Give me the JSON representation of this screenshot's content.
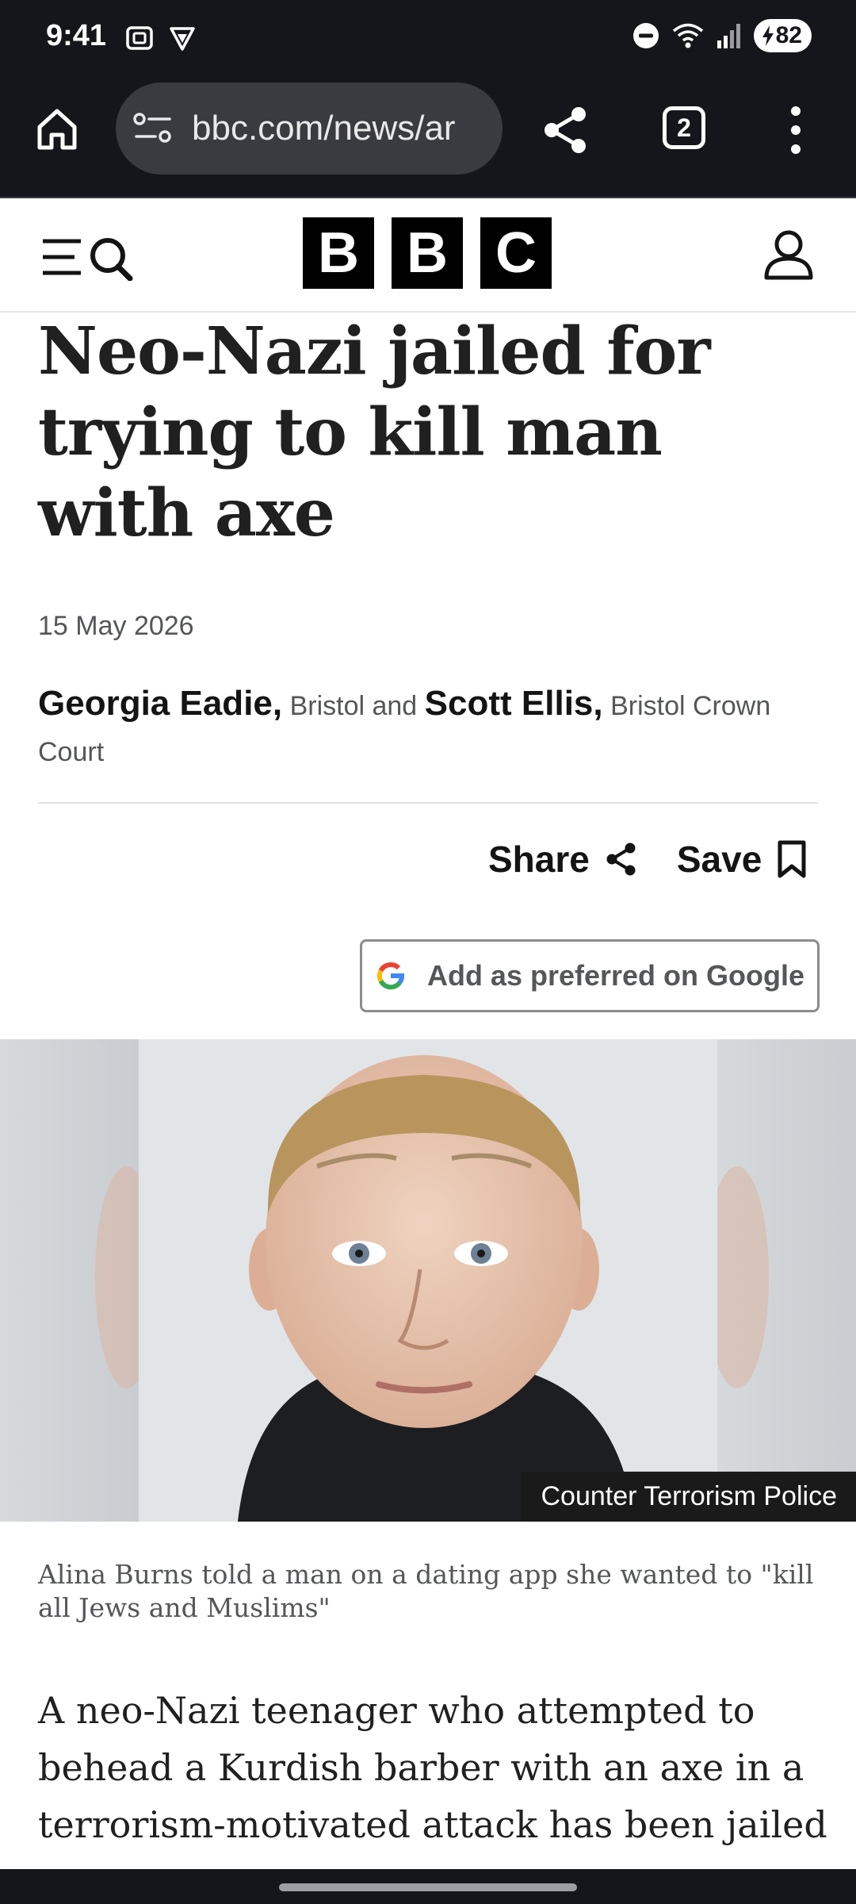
{
  "status_bar": {
    "time": "9:41",
    "battery": "82",
    "icons": [
      "screenshot-icon",
      "vpn-icon",
      "dnd-icon",
      "wifi-icon",
      "signal-icon",
      "battery-charging-icon"
    ]
  },
  "browser": {
    "url": "bbc.com/news/ar",
    "tab_count": "2",
    "icons": [
      "home-icon",
      "site-settings-icon",
      "share-icon",
      "tabs-icon",
      "more-vert-icon"
    ]
  },
  "site_header": {
    "logo": [
      "B",
      "B",
      "C"
    ],
    "icons": [
      "menu-search-icon",
      "account-icon"
    ]
  },
  "article": {
    "headline": "Neo-Nazi jailed for trying to kill man with axe",
    "date": "15 May 2026",
    "byline": {
      "author1": "Georgia Eadie,",
      "location1": "Bristol",
      "conjunction": "and",
      "author2": "Scott Ellis,",
      "location2": "Bristol Crown Court"
    },
    "share_label": "Share",
    "save_label": "Save",
    "google_button_label": "Add as preferred on Google",
    "image_credit": "Counter Terrorism Police",
    "image_caption": "Alina Burns told a man on a dating app she wanted to \"kill all Jews and Muslims\"",
    "body_first_paragraph": "A neo-Nazi teenager who attempted to behead a Kurdish barber with an axe in a terrorism-motivated attack has been jailed"
  },
  "colors": {
    "system_bar": "#15161b",
    "url_box": "#3a3b40",
    "text_primary": "#141414",
    "text_secondary": "#545658"
  }
}
